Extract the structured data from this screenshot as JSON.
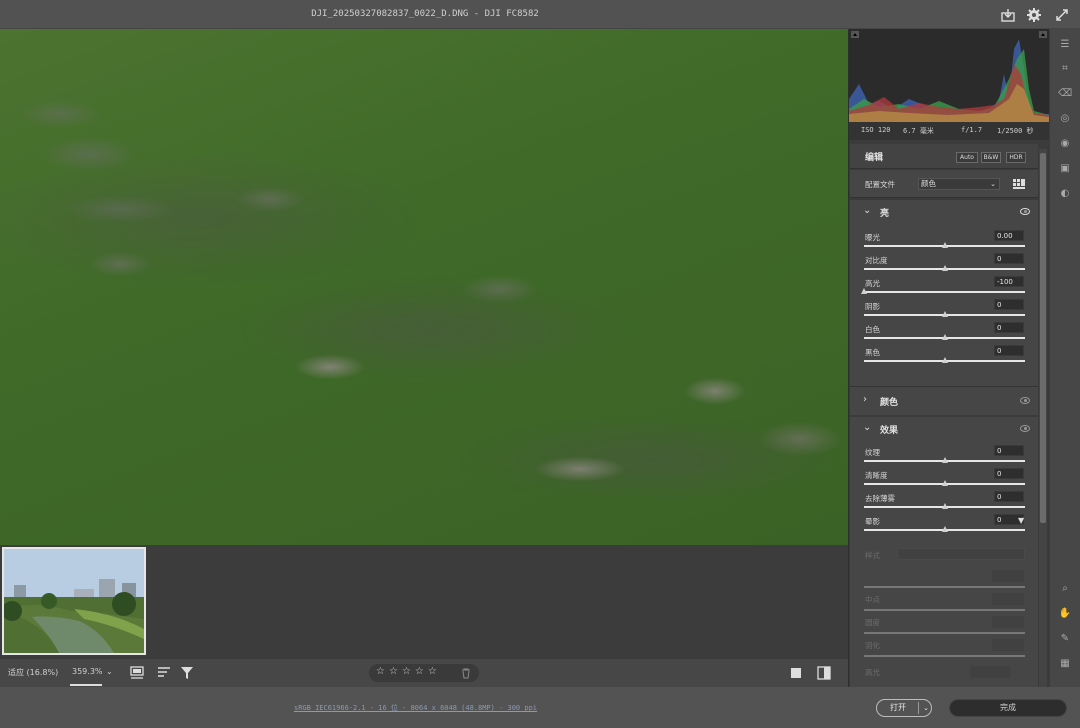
{
  "window": {
    "title": "DJI_20250327082837_0022_D.DNG - DJI FC8582"
  },
  "viewbar": {
    "fit_label": "适应 (16.8%)",
    "zoom_label": "359.3%",
    "rating_stars": [
      "☆",
      "☆",
      "☆",
      "☆",
      "☆"
    ],
    "trash_icon": "trash-icon"
  },
  "histogram_meta": {
    "iso": "ISO 120",
    "focal": "6.7 毫米",
    "aperture": "f/1.7",
    "shutter": "1/2500 秒"
  },
  "edit": {
    "title": "编辑",
    "auto_label": "Auto",
    "bw_label": "B&W",
    "hdr_label": "HDR",
    "profile_label": "配置文件",
    "profile_value": "颜色"
  },
  "light": {
    "title": "亮",
    "sliders": [
      {
        "label": "曝光",
        "value": "0.00",
        "pos": 0.5
      },
      {
        "label": "对比度",
        "value": "0",
        "pos": 0.5
      },
      {
        "label": "高光",
        "value": "-100",
        "pos": 0.0
      },
      {
        "label": "阴影",
        "value": "0",
        "pos": 0.5
      },
      {
        "label": "白色",
        "value": "0",
        "pos": 0.5
      },
      {
        "label": "黑色",
        "value": "0",
        "pos": 0.5
      }
    ]
  },
  "color": {
    "title": "颜色"
  },
  "effects": {
    "title": "效果",
    "sliders": [
      {
        "label": "纹理",
        "value": "0",
        "pos": 0.5
      },
      {
        "label": "清晰度",
        "value": "0",
        "pos": 0.5
      },
      {
        "label": "去除薄雾",
        "value": "0",
        "pos": 0.5
      },
      {
        "label": "晕影",
        "value": "0",
        "pos": 0.5
      }
    ],
    "vignette_style_label": "样式",
    "disabled": [
      "中点",
      "圆度",
      "羽化",
      "高光",
      "颗粒"
    ]
  },
  "footer": {
    "info": "sRGB IEC61966-2.1 - 16 位 - 8064 x 6048 (48.8MP) - 300 ppi",
    "open_label": "打开",
    "done_label": "完成"
  },
  "colors": {
    "panel_bg": "#3b3b3b",
    "section_bg": "#464646",
    "accent_text": "#d0d0d0"
  }
}
